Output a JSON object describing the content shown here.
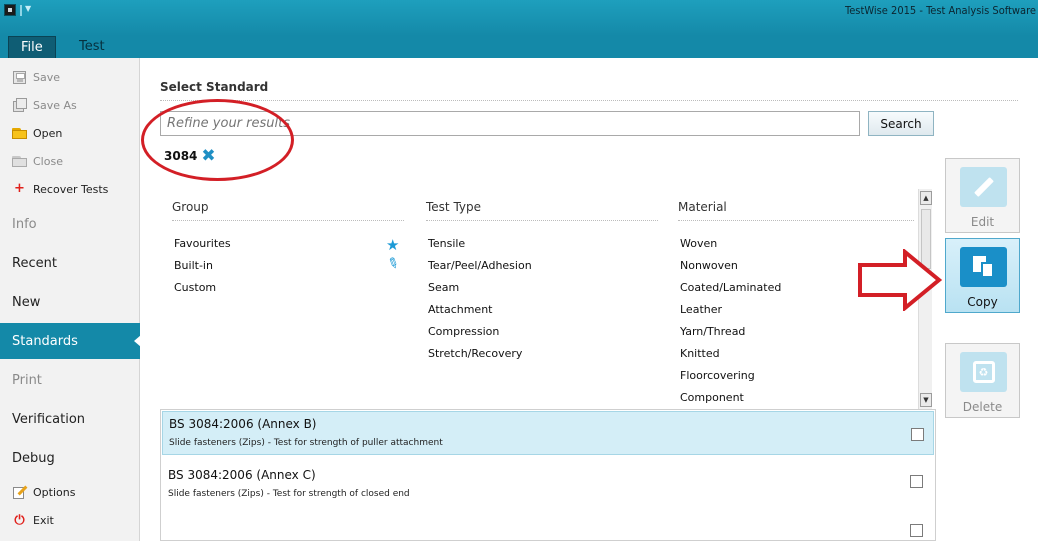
{
  "window": {
    "title": "TestWise 2015 - Test Analysis Software"
  },
  "ribbon": {
    "tabs": [
      "File",
      "Test"
    ]
  },
  "sidebar": {
    "commands": [
      {
        "label": "Save",
        "enabled": false,
        "icon": "save-icon"
      },
      {
        "label": "Save As",
        "enabled": false,
        "icon": "save-as-icon"
      },
      {
        "label": "Open",
        "enabled": true,
        "icon": "open-folder-icon"
      },
      {
        "label": "Close",
        "enabled": false,
        "icon": "close-folder-icon"
      },
      {
        "label": "Recover Tests",
        "enabled": true,
        "icon": "recover-plus-icon"
      }
    ],
    "nav": [
      {
        "label": "Info",
        "enabled": false
      },
      {
        "label": "Recent",
        "enabled": true
      },
      {
        "label": "New",
        "enabled": true
      },
      {
        "label": "Standards",
        "enabled": true,
        "active": true
      },
      {
        "label": "Print",
        "enabled": false
      },
      {
        "label": "Verification",
        "enabled": true
      },
      {
        "label": "Debug",
        "enabled": true
      }
    ],
    "footer": [
      {
        "label": "Options",
        "icon": "options-icon"
      },
      {
        "label": "Exit",
        "icon": "power-icon"
      }
    ]
  },
  "main": {
    "title": "Select Standard",
    "search": {
      "placeholder": "Refine your results",
      "value": "",
      "button": "Search"
    },
    "filter_chip": "3084",
    "columns": {
      "group": {
        "header": "Group",
        "items": [
          "Favourites",
          "Built-in",
          "Custom"
        ]
      },
      "test_type": {
        "header": "Test Type",
        "items": [
          "Tensile",
          "Tear/Peel/Adhesion",
          "Seam",
          "Attachment",
          "Compression",
          "Stretch/Recovery"
        ]
      },
      "material": {
        "header": "Material",
        "items": [
          "Woven",
          "Nonwoven",
          "Coated/Laminated",
          "Leather",
          "Yarn/Thread",
          "Knitted",
          "Floorcovering",
          "Component"
        ]
      }
    },
    "results": [
      {
        "code": "BS 3084:2006 (Annex B)",
        "description": "Slide fasteners (Zips) - Test for strength of puller attachment",
        "selected": true,
        "checked": false
      },
      {
        "code": "BS 3084:2006 (Annex C)",
        "description": "Slide fasteners (Zips) - Test for strength of closed end",
        "selected": false,
        "checked": false
      },
      {
        "code": "",
        "description": "",
        "selected": false,
        "checked": false
      }
    ]
  },
  "actions": [
    {
      "label": "Edit",
      "enabled": false,
      "icon": "edit-pencil-icon"
    },
    {
      "label": "Copy",
      "enabled": true,
      "icon": "copy-icon"
    },
    {
      "label": "Delete",
      "enabled": false,
      "icon": "recycle-bin-icon"
    }
  ],
  "colors": {
    "accent": "#1489a8",
    "annotation": "#d31f26",
    "selection": "#d4eef7"
  }
}
